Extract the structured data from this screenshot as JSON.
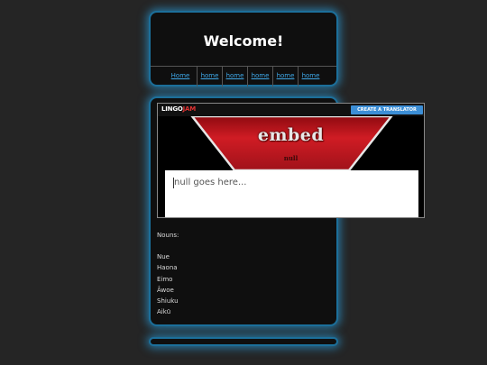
{
  "header": {
    "title": "Welcome!",
    "nav": [
      "Home",
      "home",
      "home",
      "home",
      "home",
      "home"
    ]
  },
  "widget": {
    "logo_primary": "LINGO",
    "logo_accent": "JAM",
    "create_button": "CREATE A TRANSLATOR",
    "title": "embed",
    "subtitle": "null",
    "input_placeholder": "null goes here...",
    "colors": {
      "banner_red": "#c0141c",
      "button_blue": "#3c8ed6"
    }
  },
  "content": {
    "nouns_heading": "Nouns:",
    "nouns": [
      "Nue",
      "Haona",
      "Eimo",
      "Âwoe",
      "Shiuku",
      "Aikū"
    ]
  },
  "colors": {
    "background": "#252525",
    "panel": "#0f0f0f",
    "glow": "#2896d2",
    "link": "#3fa8e8"
  }
}
